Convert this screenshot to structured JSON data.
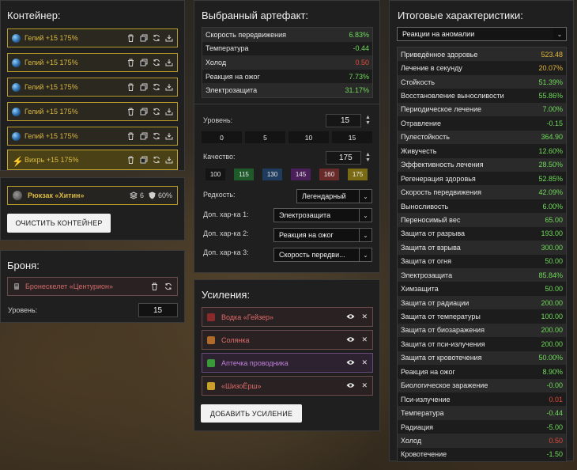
{
  "container": {
    "title": "Контейнер:",
    "slots": [
      {
        "label": "Гелий +15 175%"
      },
      {
        "label": "Гелий +15 175%"
      },
      {
        "label": "Гелий +15 175%"
      },
      {
        "label": "Гелий +15 175%"
      },
      {
        "label": "Гелий +15 175%"
      },
      {
        "label": "Вихрь +15 175%"
      }
    ],
    "backpack": {
      "label": "Рюкзак «Хитин»",
      "slots_count": "6",
      "protection": "60%"
    },
    "clear_label": "ОЧИСТИТЬ КОНТЕЙНЕР"
  },
  "armor": {
    "title": "Броня:",
    "item_label": "Бронескелет «Центурион»",
    "level_label": "Уровень:",
    "level_value": "15"
  },
  "artifact": {
    "title": "Выбранный артефакт:",
    "stats": [
      {
        "name": "Скорость передвижения",
        "value": "6.83%",
        "tone": "pos"
      },
      {
        "name": "Температура",
        "value": "-0.44",
        "tone": "pos"
      },
      {
        "name": "Холод",
        "value": "0.50",
        "tone": "neg"
      },
      {
        "name": "Реакция на ожог",
        "value": "7.73%",
        "tone": "pos"
      },
      {
        "name": "Электрозащита",
        "value": "31.17%",
        "tone": "pos"
      }
    ],
    "level_label": "Уровень:",
    "level_value": "15",
    "level_presets": [
      "0",
      "5",
      "10",
      "15"
    ],
    "quality_label": "Качество:",
    "quality_value": "175",
    "quality_presets": [
      {
        "label": "100",
        "color": "#141414"
      },
      {
        "label": "115",
        "color": "#1f5a2a"
      },
      {
        "label": "130",
        "color": "#1f3c5e"
      },
      {
        "label": "145",
        "color": "#4a1f5a"
      },
      {
        "label": "160",
        "color": "#6a2a2a"
      },
      {
        "label": "175",
        "color": "#7a6a14"
      }
    ],
    "rarity_label": "Редкость:",
    "rarity_value": "Легендарный",
    "extra1_label": "Доп. хар-ка 1:",
    "extra1_value": "Электрозащита",
    "extra2_label": "Доп. хар-ка 2:",
    "extra2_value": "Реакция на ожог",
    "extra3_label": "Доп. хар-ка 3:",
    "extra3_value": "Скорость передви..."
  },
  "boosts": {
    "title": "Усиления:",
    "items": [
      {
        "label": "Водка «Гейзер»",
        "color": "#e06a6a",
        "icon_color": "#8a2a2a"
      },
      {
        "label": "Солянка",
        "color": "#e06a6a",
        "icon_color": "#b06a2a"
      },
      {
        "label": "Аптечка проводника",
        "color": "#c080d8",
        "icon_color": "#3a9a3a"
      },
      {
        "label": "«ШизоЁрш»",
        "color": "#e06a6a",
        "icon_color": "#c8a02a"
      }
    ],
    "add_label": "ДОБАВИТЬ УСИЛЕНИЕ"
  },
  "summary": {
    "title": "Итоговые характеристики:",
    "filter_value": "Реакции на аномалии",
    "stats": [
      {
        "name": "Приведённое здоровье",
        "value": "523.48",
        "tone": "gold"
      },
      {
        "name": "Лечение в секунду",
        "value": "20.07%",
        "tone": "gold"
      },
      {
        "name": "Стойкость",
        "value": "51.39%",
        "tone": "pos"
      },
      {
        "name": "Восстановление выносливости",
        "value": "55.86%",
        "tone": "pos"
      },
      {
        "name": "Периодическое лечение",
        "value": "7.00%",
        "tone": "pos"
      },
      {
        "name": "Отравление",
        "value": "-0.15",
        "tone": "pos"
      },
      {
        "name": "Пулестойкость",
        "value": "364.90",
        "tone": "pos"
      },
      {
        "name": "Живучесть",
        "value": "12.60%",
        "tone": "pos"
      },
      {
        "name": "Эффективность лечения",
        "value": "28.50%",
        "tone": "pos"
      },
      {
        "name": "Регенерация здоровья",
        "value": "52.85%",
        "tone": "pos"
      },
      {
        "name": "Скорость передвижения",
        "value": "42.09%",
        "tone": "pos"
      },
      {
        "name": "Выносливость",
        "value": "6.00%",
        "tone": "pos"
      },
      {
        "name": "Переносимый вес",
        "value": "65.00",
        "tone": "pos"
      },
      {
        "name": "Защита от разрыва",
        "value": "193.00",
        "tone": "pos"
      },
      {
        "name": "Защита от взрыва",
        "value": "300.00",
        "tone": "pos"
      },
      {
        "name": "Защита от огня",
        "value": "50.00",
        "tone": "pos"
      },
      {
        "name": "Электрозащита",
        "value": "85.84%",
        "tone": "pos"
      },
      {
        "name": "Химзащита",
        "value": "50.00",
        "tone": "pos"
      },
      {
        "name": "Защита от радиации",
        "value": "200.00",
        "tone": "pos"
      },
      {
        "name": "Защита от температуры",
        "value": "100.00",
        "tone": "pos"
      },
      {
        "name": "Защита от биозаражения",
        "value": "200.00",
        "tone": "pos"
      },
      {
        "name": "Защита от пси-излучения",
        "value": "200.00",
        "tone": "pos"
      },
      {
        "name": "Защита от кровотечения",
        "value": "50.00%",
        "tone": "pos"
      },
      {
        "name": "Реакция на ожог",
        "value": "8.90%",
        "tone": "pos"
      },
      {
        "name": "Биологическое заражение",
        "value": "-0.00",
        "tone": "pos"
      },
      {
        "name": "Пси-излучение",
        "value": "0.01",
        "tone": "neg"
      },
      {
        "name": "Температура",
        "value": "-0.44",
        "tone": "pos"
      },
      {
        "name": "Радиация",
        "value": "-5.00",
        "tone": "pos"
      },
      {
        "name": "Холод",
        "value": "0.50",
        "tone": "neg"
      },
      {
        "name": "Кровотечение",
        "value": "-1.50",
        "tone": "pos"
      }
    ]
  }
}
